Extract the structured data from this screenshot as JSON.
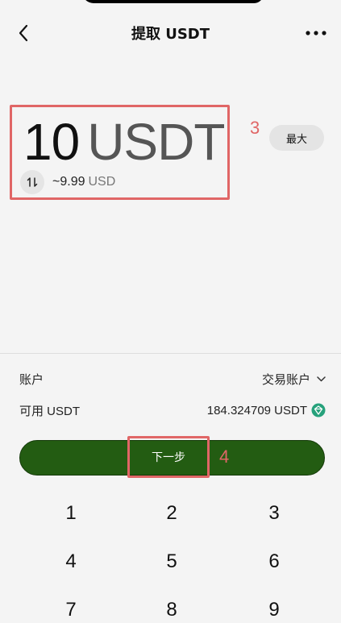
{
  "header": {
    "title": "提取 USDT",
    "back_icon": "chevron-left-icon",
    "more_icon": "more-horizontal-icon"
  },
  "amount": {
    "value": "10",
    "unit": "USDT",
    "approx_value": "~9.99",
    "approx_unit": "USD",
    "swap_icon": "swap-vertical-icon"
  },
  "max_button": {
    "label": "最大"
  },
  "annotations": {
    "amount": "3",
    "next": "4"
  },
  "account": {
    "label": "账户",
    "value": "交易账户"
  },
  "available": {
    "label": "可用 USDT",
    "value": "184.324709 USDT",
    "token_icon": "tether-icon"
  },
  "next_button": {
    "label": "下一步"
  },
  "keypad": {
    "keys": [
      "1",
      "2",
      "3",
      "4",
      "5",
      "6",
      "7",
      "8",
      "9"
    ]
  },
  "colors": {
    "accent_green": "#235c12",
    "annotation_red": "#e06666",
    "tether_teal": "#26a17b",
    "background": "#f4f4f4"
  }
}
